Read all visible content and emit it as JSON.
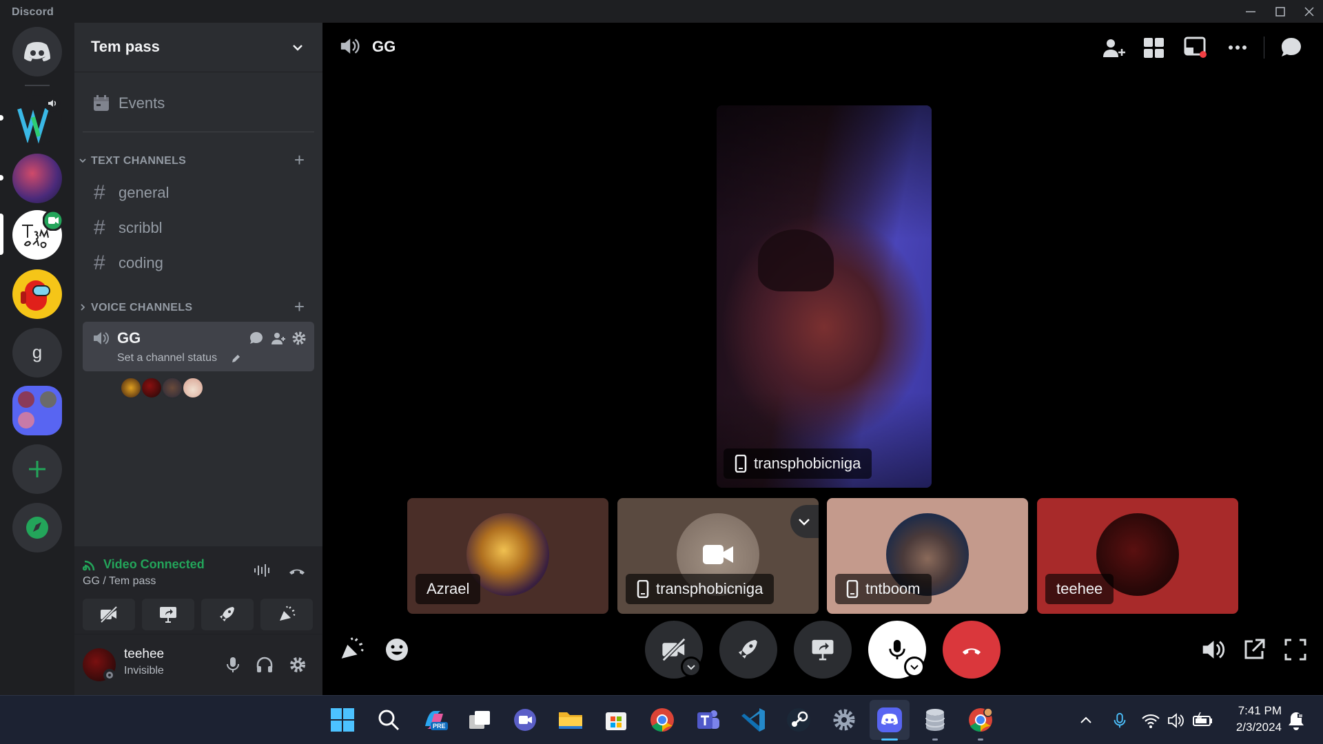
{
  "app": {
    "title": "Discord"
  },
  "server": {
    "name": "Tem pass"
  },
  "sidebar": {
    "events_label": "Events",
    "text_category": "TEXT CHANNELS",
    "text_channels": [
      "general",
      "scribbl",
      "coding"
    ],
    "voice_category": "VOICE CHANNELS",
    "voice_channel": {
      "name": "GG",
      "status_placeholder": "Set a channel status"
    }
  },
  "rail": {
    "g_label": "g"
  },
  "voice": {
    "status": "Video Connected",
    "location": "GG / Tem pass"
  },
  "user": {
    "name": "teehee",
    "status": "Invisible"
  },
  "main": {
    "channel_name": "GG",
    "featured": {
      "name": "transphobicniga"
    },
    "tiles": [
      {
        "name": "Azrael"
      },
      {
        "name": "transphobicniga"
      },
      {
        "name": "tntboom"
      },
      {
        "name": "teehee"
      }
    ]
  },
  "taskbar": {
    "time": "7:41 PM",
    "date": "2/3/2024",
    "copilot_badge": "PRE"
  },
  "colors": {
    "accent": "#5865f2",
    "green": "#23a55a",
    "danger": "#da373c"
  }
}
